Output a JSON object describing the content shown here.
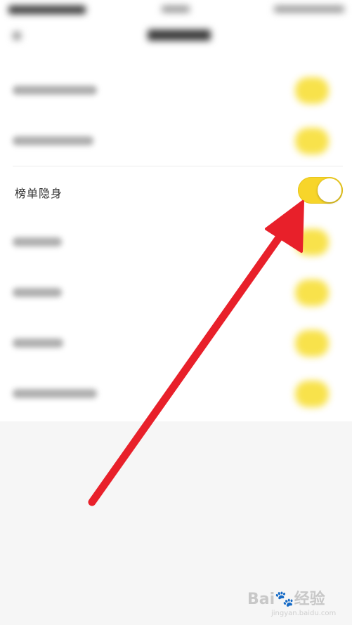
{
  "setting_row": {
    "label": "榜单隐身",
    "toggle_state": "on"
  },
  "colors": {
    "toggle_on": "#f7d52a",
    "arrow": "#e8202a",
    "panel": "#ffffff",
    "background": "#f6f6f6"
  },
  "watermark": {
    "brand": "Bai&#xE000;经验",
    "brand_text": "Bai",
    "brand_suffix": "经验",
    "url": "jingyan.baidu.com"
  }
}
